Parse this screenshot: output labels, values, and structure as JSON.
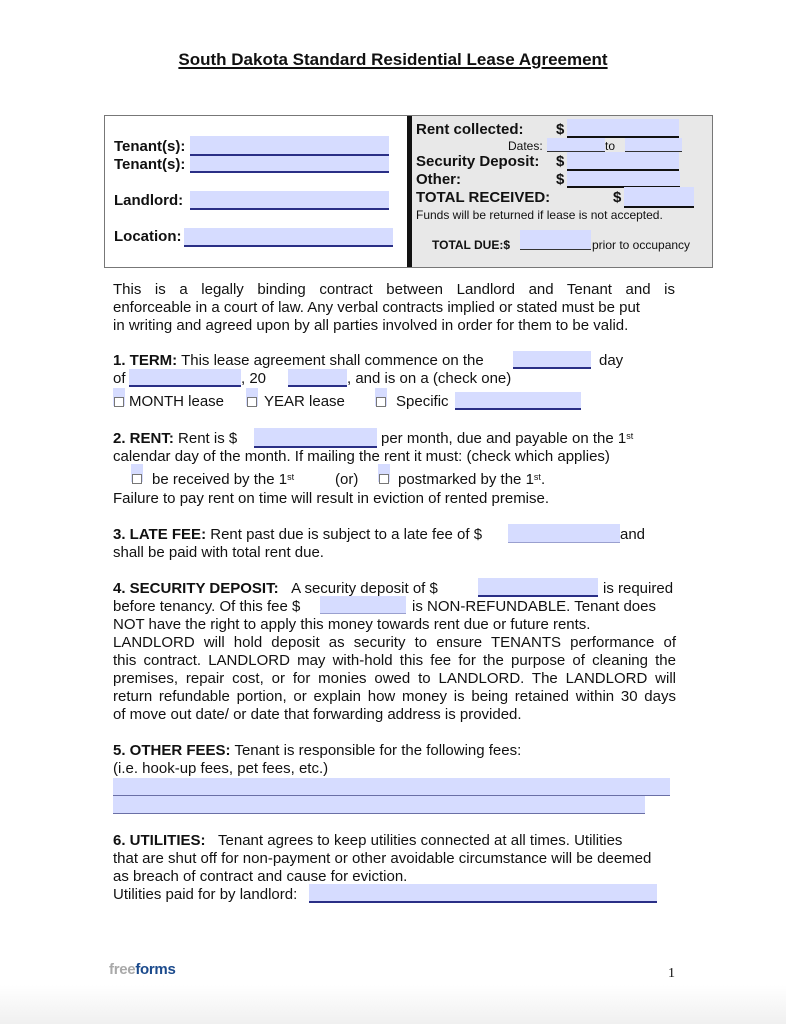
{
  "document": {
    "title": "South Dakota Standard Residential Lease Agreement",
    "page_number": "1",
    "logo": {
      "part1": "free",
      "part2": "forms",
      "part1_color": "#a9a9a9",
      "part2_color": "#1b4a8c"
    }
  },
  "header_left": {
    "tenant1_label": "Tenant(s):",
    "tenant1_value": "",
    "tenant2_label": "Tenant(s):",
    "tenant2_value": "",
    "landlord_label": "Landlord:",
    "landlord_value": "",
    "location_label": "Location:",
    "location_value": ""
  },
  "header_right": {
    "rent_collected_label": "Rent collected:",
    "rent_collected_value": "",
    "dates_label": "Dates:",
    "dates_from": "",
    "dates_to_label": "to",
    "dates_to": "",
    "security_deposit_label": "Security Deposit:",
    "security_deposit_value": "",
    "other_label": "Other:",
    "other_value": "",
    "total_received_label": "TOTAL RECEIVED:",
    "total_received_value": "",
    "dollar": "$",
    "funds_note": "Funds will be returned if lease is not accepted.",
    "total_due_label": "TOTAL DUE:$",
    "total_due_value": "",
    "total_due_suffix": "prior to occupancy"
  },
  "intro": {
    "lines": [
      "This is a legally binding contract between Landlord and Tenant and is",
      "enforceable in a court of law.  Any verbal contracts implied or stated must be put",
      "in writing and agreed upon by all parties involved in order for them to be valid."
    ]
  },
  "term": {
    "heading": "1.  TERM:",
    "text1": "This lease agreement shall commence on the",
    "day_value": "",
    "text2": "day",
    "of": "of",
    "month_value": "",
    "year_prefix": ", 20",
    "year_value": "",
    "text3": ", and is on a (check one)",
    "options": [
      {
        "label": "MONTH lease",
        "checked": false
      },
      {
        "label": "YEAR lease",
        "checked": false
      },
      {
        "label": "Specific",
        "checked": false
      }
    ],
    "specific_value": ""
  },
  "rent": {
    "heading": "2.   RENT:",
    "text1": "Rent is $",
    "amount_value": "",
    "text2": "per month, due and payable on the 1",
    "sup": "st",
    "line2": "calendar day of the month.  If mailing the rent it must: (check which applies)",
    "option1": "be received by the 1",
    "or": "(or)",
    "option2": "postmarked by the 1",
    "option2_end": ".",
    "option1_checked": false,
    "option2_checked": false,
    "line4": "Failure to pay rent on time will result in eviction of rented premise."
  },
  "late_fee": {
    "heading": "3.  LATE FEE:",
    "text1": "Rent past due is subject to a late fee of $",
    "fee_value": "",
    "text2": "and",
    "line2": "shall be paid with total rent due."
  },
  "security_deposit": {
    "heading": "4.  SECURITY DEPOSIT:",
    "text1": "A security deposit of $",
    "amount_value": "",
    "text2": "is required",
    "line2a": "before tenancy.  Of this fee $",
    "nonrefundable_value": "",
    "line2b": "is NON-REFUNDABLE.  Tenant does",
    "lines": [
      "NOT have the right to apply this money towards rent due or future rents.",
      "LANDLORD will hold deposit as security to ensure TENANTS performance of",
      "this contract.  LANDLORD may with-hold this fee for the purpose of cleaning the",
      "premises, repair cost, or for monies owed to LANDLORD.  The LANDLORD will",
      "return refundable portion, or explain how money is being retained within 30 days",
      "of move out date/ or date that forwarding address is provided."
    ]
  },
  "other_fees": {
    "heading": "5.  OTHER FEES:",
    "text1": "Tenant is responsible for the following fees:",
    "line2": " (i.e. hook-up fees, pet fees, etc.)",
    "field1_value": "",
    "field2_value": ""
  },
  "utilities": {
    "heading": "6.  UTILITIES:",
    "text1": "Tenant agrees to keep utilities connected at all times.  Utilities",
    "line2": "that are shut off for non-payment or other avoidable circumstance will be deemed",
    "line3": "as breach of contract and cause for eviction.",
    "line4": "Utilities paid for by landlord:",
    "landlord_paid_value": ""
  }
}
